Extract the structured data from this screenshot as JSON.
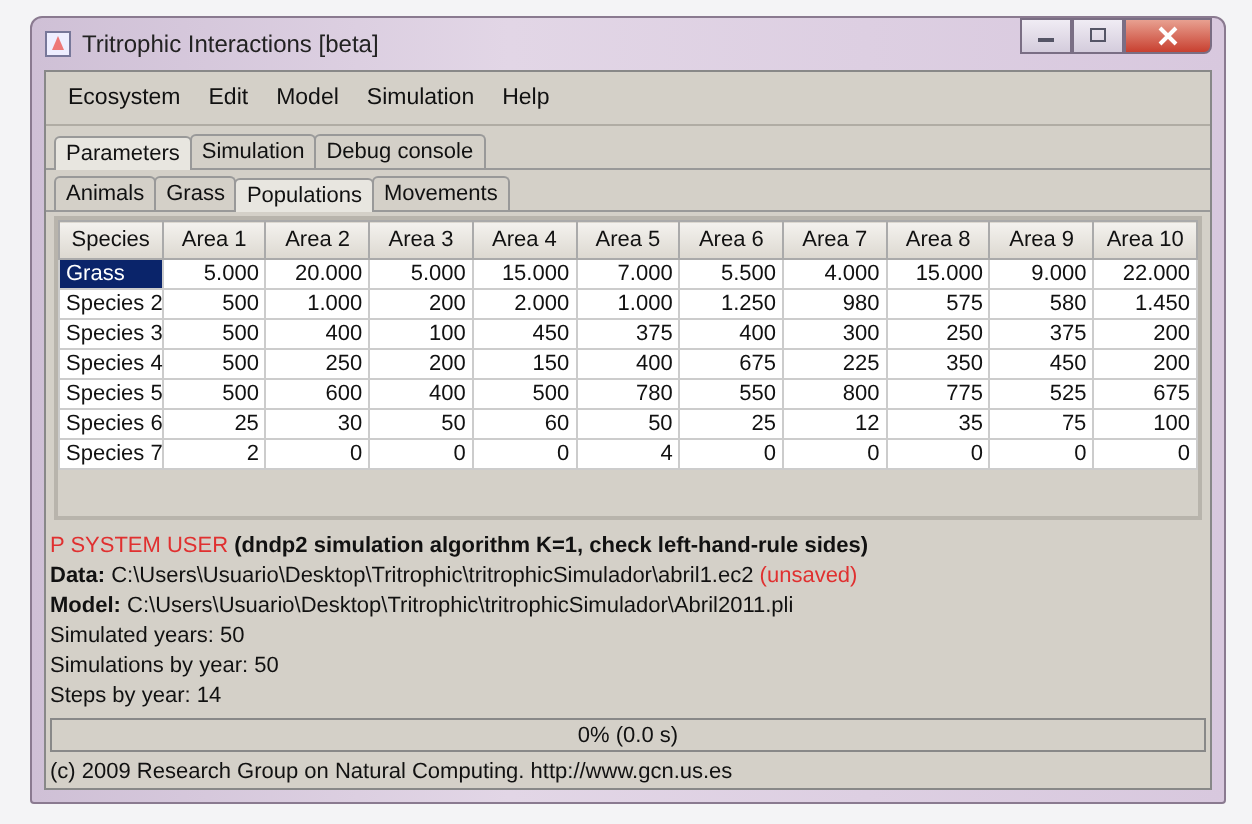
{
  "window": {
    "title": "Tritrophic Interactions [beta]"
  },
  "menu": [
    "Ecosystem",
    "Edit",
    "Model",
    "Simulation",
    "Help"
  ],
  "tabs": [
    {
      "label": "Parameters",
      "selected": true
    },
    {
      "label": "Simulation",
      "selected": false
    },
    {
      "label": "Debug console",
      "selected": false
    }
  ],
  "subtabs": [
    {
      "label": "Animals",
      "selected": false
    },
    {
      "label": "Grass",
      "selected": false
    },
    {
      "label": "Populations",
      "selected": true
    },
    {
      "label": "Movements",
      "selected": false
    }
  ],
  "table": {
    "columns": [
      "Species",
      "Area 1",
      "Area 2",
      "Area 3",
      "Area 4",
      "Area 5",
      "Area 6",
      "Area 7",
      "Area 8",
      "Area 9",
      "Area 10"
    ],
    "rows": [
      {
        "name": "Grass",
        "selected": true,
        "values": [
          "5.000",
          "20.000",
          "5.000",
          "15.000",
          "7.000",
          "5.500",
          "4.000",
          "15.000",
          "9.000",
          "22.000"
        ]
      },
      {
        "name": "Species 2",
        "selected": false,
        "values": [
          "500",
          "1.000",
          "200",
          "2.000",
          "1.000",
          "1.250",
          "980",
          "575",
          "580",
          "1.450"
        ]
      },
      {
        "name": "Species 3",
        "selected": false,
        "values": [
          "500",
          "400",
          "100",
          "450",
          "375",
          "400",
          "300",
          "250",
          "375",
          "200"
        ]
      },
      {
        "name": "Species 4",
        "selected": false,
        "values": [
          "500",
          "250",
          "200",
          "150",
          "400",
          "675",
          "225",
          "350",
          "450",
          "200"
        ]
      },
      {
        "name": "Species 5",
        "selected": false,
        "values": [
          "500",
          "600",
          "400",
          "500",
          "780",
          "550",
          "800",
          "775",
          "525",
          "675"
        ]
      },
      {
        "name": "Species 6",
        "selected": false,
        "values": [
          "25",
          "30",
          "50",
          "60",
          "50",
          "25",
          "12",
          "35",
          "75",
          "100"
        ]
      },
      {
        "name": "Species 7",
        "selected": false,
        "values": [
          "2",
          "0",
          "0",
          "0",
          "4",
          "0",
          "0",
          "0",
          "0",
          "0"
        ]
      }
    ]
  },
  "info": {
    "user": "P SYSTEM USER",
    "algorithm": "(dndp2 simulation algorithm K=1, check left-hand-rule sides)",
    "data_label": "Data:",
    "data_path": "C:\\Users\\Usuario\\Desktop\\Tritrophic\\tritrophicSimulador\\abril1.ec2",
    "data_flag": "(unsaved)",
    "model_label": "Model:",
    "model_path": "C:\\Users\\Usuario\\Desktop\\Tritrophic\\tritrophicSimulador\\Abril2011.pli",
    "lines": [
      "Simulated years: 50",
      "Simulations by year: 50",
      "Steps by year: 14"
    ]
  },
  "progress": {
    "text": "0% (0.0 s)"
  },
  "footer": "(c) 2009 Research Group on Natural Computing. http://www.gcn.us.es"
}
